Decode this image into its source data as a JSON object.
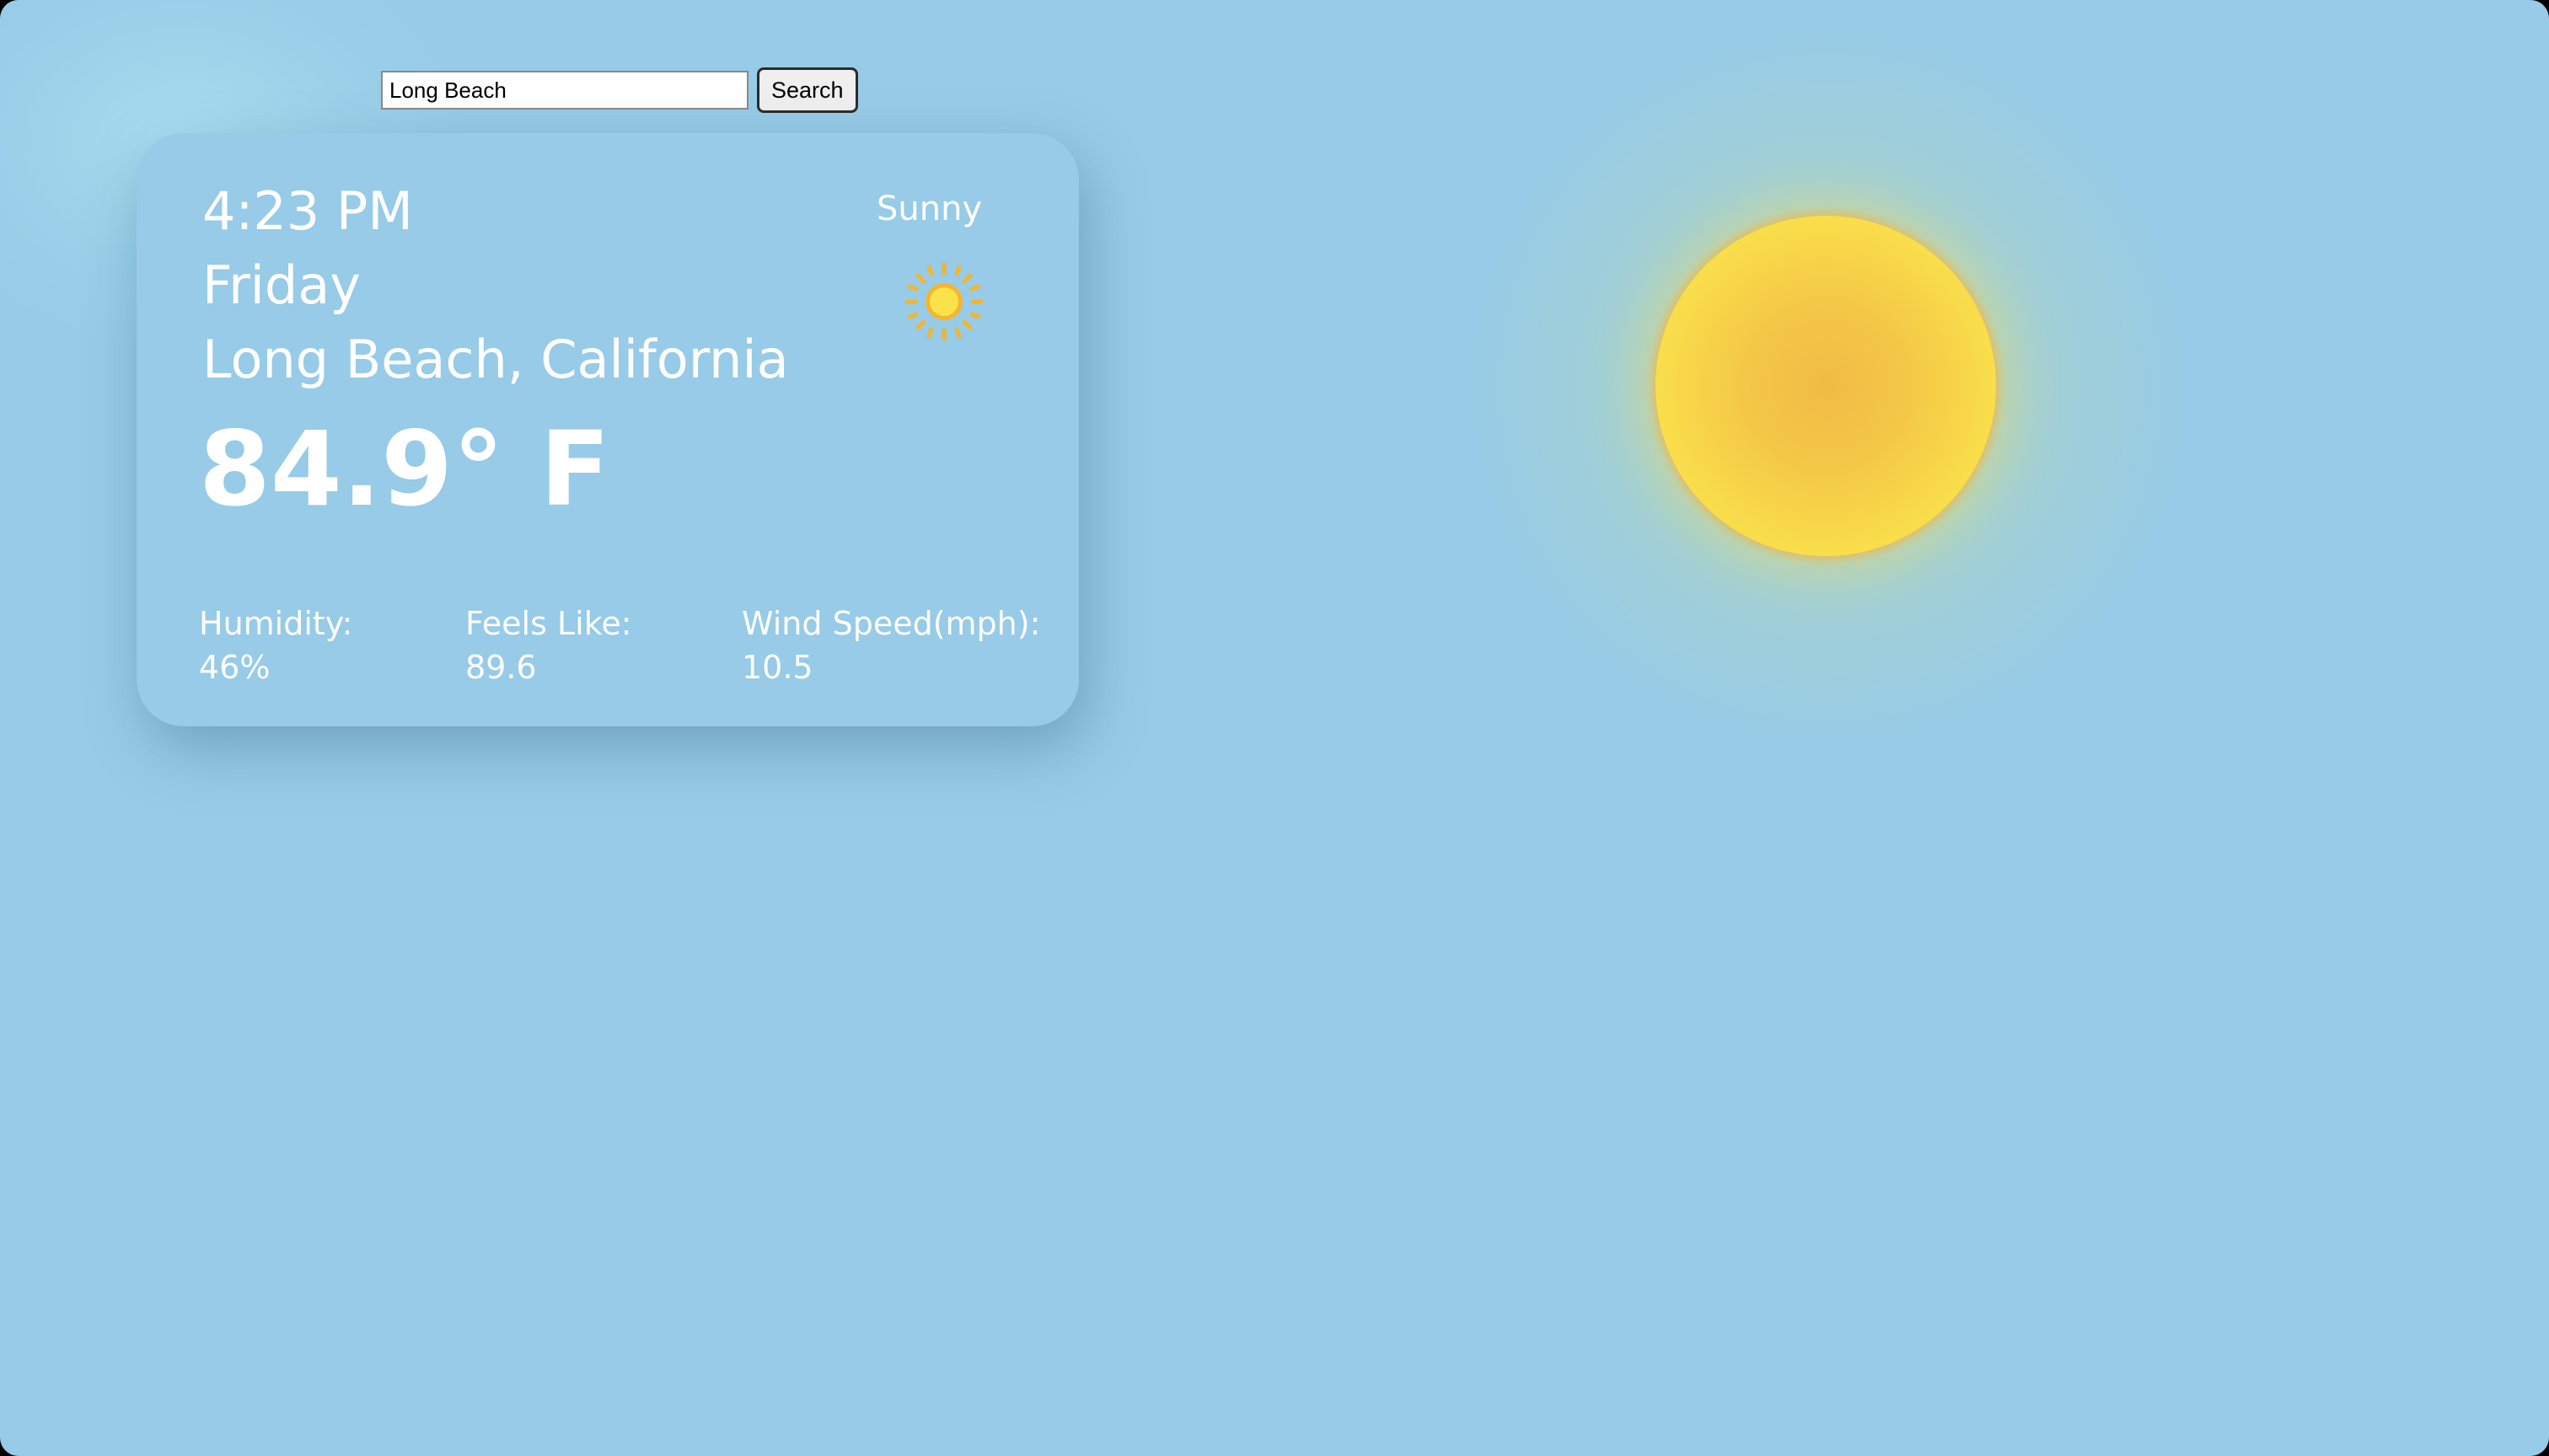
{
  "search": {
    "value": "Long Beach",
    "button_label": "Search"
  },
  "weather": {
    "time": "4:23 PM",
    "day": "Friday",
    "location": "Long Beach, California",
    "temperature": "84.9° F",
    "condition": "Sunny",
    "condition_icon": "sun-icon",
    "stats": {
      "humidity": {
        "label": "Humidity:",
        "value": "46%"
      },
      "feels_like": {
        "label": "Feels Like:",
        "value": "89.6"
      },
      "wind_speed": {
        "label": "Wind Speed(mph):",
        "value": "10.5"
      }
    }
  },
  "colors": {
    "background": "#97cbe7",
    "card": "#97cbe7",
    "text": "#ffffff",
    "sun_center": "#f1bb45",
    "sun_edge": "#fde64c"
  }
}
